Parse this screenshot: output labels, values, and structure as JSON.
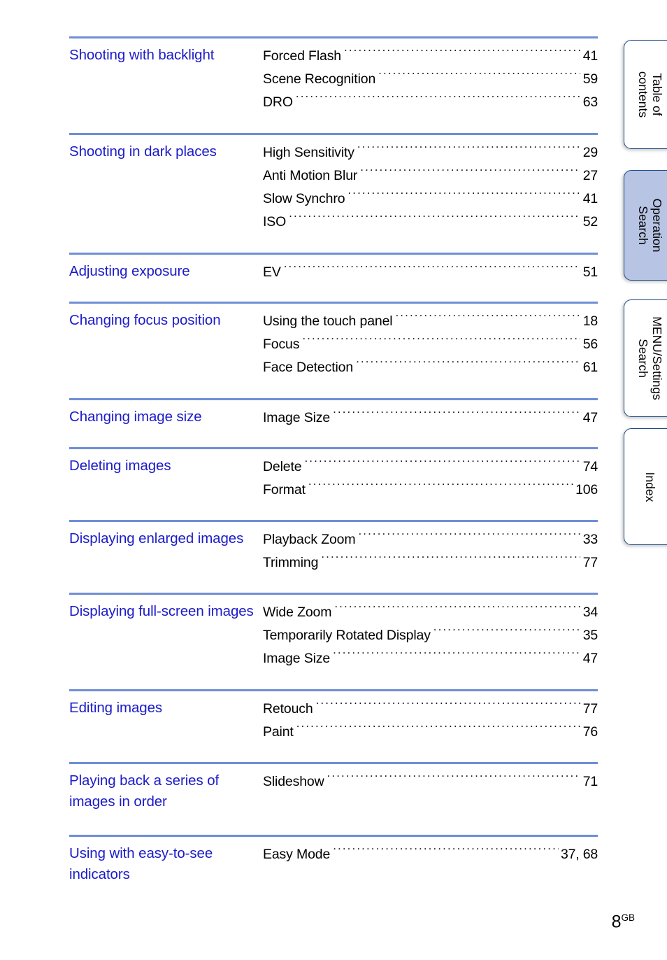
{
  "document": {
    "page_label": "8",
    "page_label_suffix": "GB"
  },
  "side_tabs": [
    {
      "line1": "Table of",
      "line2": "contents",
      "active": false
    },
    {
      "line1": "Operation",
      "line2": "Search",
      "active": true
    },
    {
      "line1": "MENU/Settings",
      "line2": "Search",
      "active": false
    },
    {
      "line1": "Index",
      "line2": "",
      "active": false
    }
  ],
  "colors": {
    "heading": "#1b1bc9",
    "rule": "#6f8ed6",
    "tab_border": "#1c4a86",
    "tab_active_fill": "#b8c4e4"
  },
  "sections": [
    {
      "title": "Shooting with backlight",
      "entries": [
        {
          "label": "Forced Flash",
          "page": "41"
        },
        {
          "label": "Scene Recognition",
          "page": "59"
        },
        {
          "label": "DRO",
          "page": "63"
        }
      ]
    },
    {
      "title": "Shooting in dark places",
      "entries": [
        {
          "label": "High Sensitivity",
          "page": "29"
        },
        {
          "label": "Anti Motion Blur",
          "page": "27"
        },
        {
          "label": "Slow Synchro",
          "page": "41"
        },
        {
          "label": "ISO",
          "page": "52"
        }
      ]
    },
    {
      "title": "Adjusting exposure",
      "entries": [
        {
          "label": "EV",
          "page": "51"
        }
      ]
    },
    {
      "title": "Changing focus position",
      "entries": [
        {
          "label": "Using the touch panel",
          "page": "18"
        },
        {
          "label": "Focus",
          "page": "56"
        },
        {
          "label": "Face Detection",
          "page": "61"
        }
      ]
    },
    {
      "title": "Changing image size",
      "entries": [
        {
          "label": "Image Size",
          "page": "47"
        }
      ]
    },
    {
      "title": "Deleting images",
      "entries": [
        {
          "label": "Delete",
          "page": "74"
        },
        {
          "label": "Format",
          "page": "106"
        }
      ]
    },
    {
      "title": "Displaying enlarged images",
      "entries": [
        {
          "label": "Playback Zoom",
          "page": "33"
        },
        {
          "label": "Trimming",
          "page": "77"
        }
      ]
    },
    {
      "title": "Displaying full-screen images",
      "entries": [
        {
          "label": "Wide Zoom",
          "page": "34"
        },
        {
          "label": "Temporarily Rotated Display",
          "page": "35"
        },
        {
          "label": "Image Size",
          "page": "47"
        }
      ]
    },
    {
      "title": "Editing images",
      "entries": [
        {
          "label": "Retouch",
          "page": "77"
        },
        {
          "label": "Paint",
          "page": "76"
        }
      ]
    },
    {
      "title": "Playing back a series of images in order",
      "entries": [
        {
          "label": "Slideshow",
          "page": "71"
        }
      ]
    },
    {
      "title": "Using with easy-to-see indicators",
      "entries": [
        {
          "label": "Easy Mode",
          "page": "37, 68"
        }
      ]
    }
  ]
}
